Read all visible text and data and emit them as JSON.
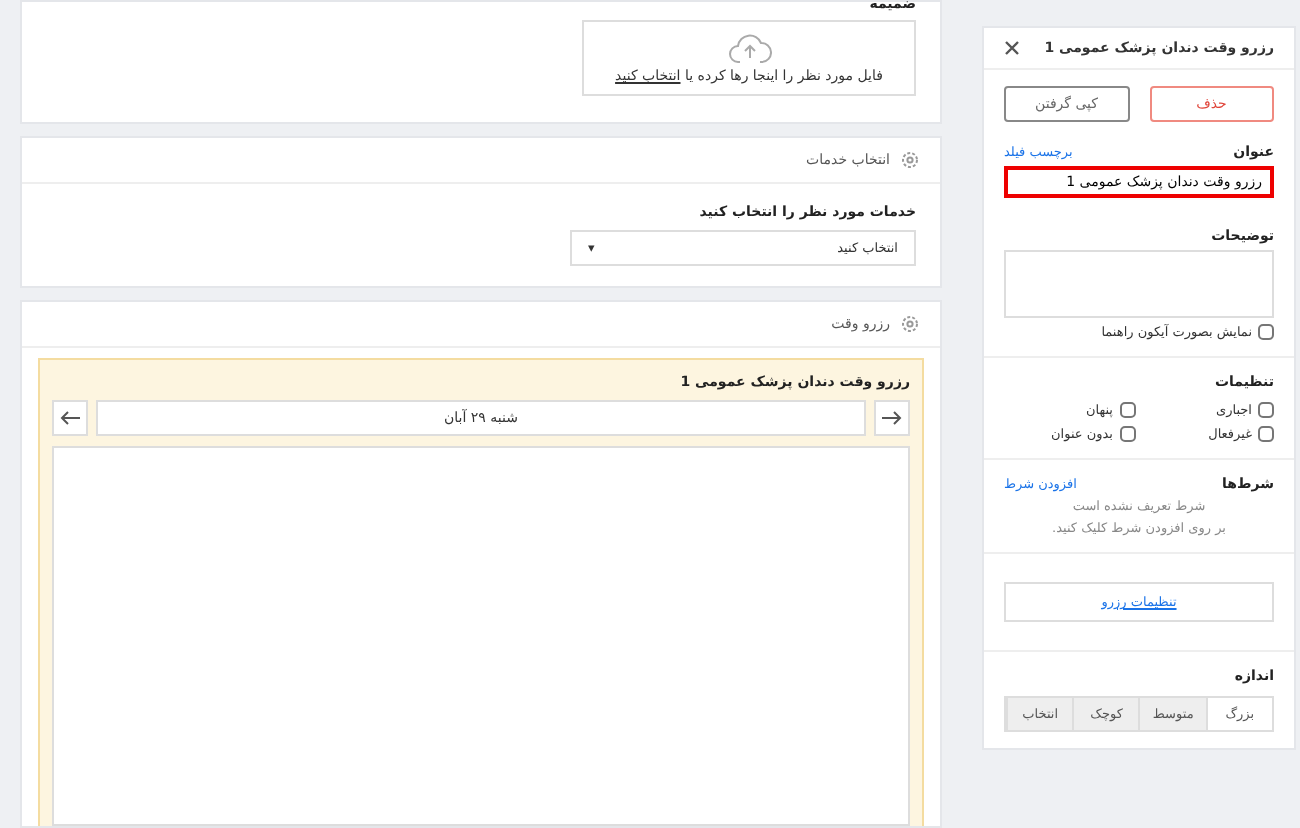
{
  "attachment": {
    "label": "ضمیمه",
    "upload_text": "فایل مورد نظر را اینجا رها کرده یا",
    "upload_link": "انتخاب کنید"
  },
  "services": {
    "title": "انتخاب خدمات",
    "field_label": "خدمات مورد نظر را انتخاب کنید",
    "select_value": "انتخاب کنید",
    "caret": "▾"
  },
  "booking": {
    "title": "رزرو وقت",
    "widget_title": "رزرو وقت دندان پزشک عمومی 1",
    "date": "شنبه ۲۹ آبان"
  },
  "panel": {
    "title": "رزرو وقت دندان پزشک عمومی 1",
    "delete_button": "حذف",
    "copy_button": "کپی گرفتن",
    "title_label": "عنوان",
    "field_label_link": "برچسب فیلد",
    "title_value": "رزرو وقت دندان پزشک عمومی 1",
    "description_label": "توضیحات",
    "tooltip_option": {
      "label": "نمایش بصورت آیکون راهنما",
      "checked": false
    },
    "settings_label": "تنظیمات",
    "settings": [
      {
        "label": "اجباری",
        "checked": false
      },
      {
        "label": "پنهان",
        "checked": false
      },
      {
        "label": "غیرفعال",
        "checked": false
      },
      {
        "label": "بدون عنوان",
        "checked": false
      }
    ],
    "conditions_label": "شرط‌ها",
    "add_condition": "افزودن شرط",
    "conditions_empty": "شرط تعریف نشده است",
    "conditions_hint": "بر روی افزودن شرط کلیک کنید.",
    "booking_settings": "تنظیمات رزرو",
    "size_label": "اندازه",
    "sizes": [
      {
        "label": "بزرگ",
        "selected": true
      },
      {
        "label": "متوسط",
        "selected": false
      },
      {
        "label": "کوچک",
        "selected": false
      },
      {
        "label": "انتخاب",
        "selected": false
      }
    ]
  }
}
